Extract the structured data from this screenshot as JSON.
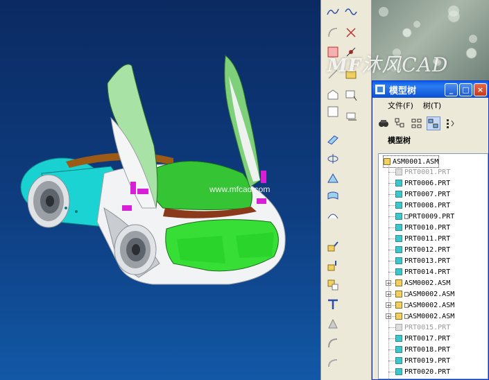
{
  "viewport": {
    "watermark": "www.mfcad.com"
  },
  "logo": {
    "brand": "MF",
    "text": "沐风CAD"
  },
  "tree_window": {
    "title": "模型树",
    "buttons": [
      "_",
      "□",
      "×"
    ],
    "menu": [
      "文件(F)",
      "树(T)"
    ],
    "header": "模型树",
    "items": [
      {
        "label": "ASM0001.ASM",
        "kind": "asm",
        "level": 0
      },
      {
        "label": "PRT0001.PRT",
        "kind": "grey",
        "level": 1
      },
      {
        "label": "PRT0006.PRT",
        "kind": "prt",
        "level": 1
      },
      {
        "label": "PRT0007.PRT",
        "kind": "prt",
        "level": 1
      },
      {
        "label": "PRT0008.PRT",
        "kind": "prt",
        "level": 1
      },
      {
        "label": "□PRT0009.PRT",
        "kind": "prt",
        "level": 1
      },
      {
        "label": "PRT0010.PRT",
        "kind": "prt",
        "level": 1
      },
      {
        "label": "PRT0011.PRT",
        "kind": "prt",
        "level": 1
      },
      {
        "label": "PRT0012.PRT",
        "kind": "prt",
        "level": 1
      },
      {
        "label": "PRT0013.PRT",
        "kind": "prt",
        "level": 1
      },
      {
        "label": "PRT0014.PRT",
        "kind": "prt",
        "level": 1
      },
      {
        "label": "ASM0002.ASM",
        "kind": "asm",
        "level": 1,
        "expandable": true
      },
      {
        "label": "□ASM0002.ASM",
        "kind": "asm",
        "level": 1,
        "expandable": true
      },
      {
        "label": "□ASM0002.ASM",
        "kind": "asm",
        "level": 1,
        "expandable": true
      },
      {
        "label": "□ASM0002.ASM",
        "kind": "asm",
        "level": 1,
        "expandable": true
      },
      {
        "label": "PRT0015.PRT",
        "kind": "grey",
        "level": 1
      },
      {
        "label": "PRT0017.PRT",
        "kind": "prt",
        "level": 1
      },
      {
        "label": "PRT0018.PRT",
        "kind": "prt",
        "level": 1
      },
      {
        "label": "PRT0019.PRT",
        "kind": "prt",
        "level": 1
      },
      {
        "label": "PRT0020.PRT",
        "kind": "prt",
        "level": 1
      }
    ]
  },
  "toolbar": {
    "icons": [
      "datum-curve-icon",
      "sketch-curve-icon",
      "arc-icon",
      "csys-cross-icon",
      "plane-icon",
      "point-icon",
      "axis-icon",
      "analysis-icon",
      "plane2-icon",
      "sketch-icon",
      "rect-icon",
      "sweep-icon",
      "extrude-icon",
      "revolve-icon",
      "sweep2-icon",
      "blend-icon",
      "surface-icon",
      "assemble-icon",
      "insert-icon",
      "copy-icon",
      "trim-icon",
      "merge-icon",
      "offset-icon",
      "round-icon"
    ]
  },
  "colors": {
    "viewport_top": "#0b2a62",
    "viewport_bottom": "#1258a6",
    "title_blue": "#0a5fe6",
    "green_body": "#3dcf3d",
    "cyan_body": "#19d5d5",
    "magenta_hinge": "#d81fd8"
  }
}
